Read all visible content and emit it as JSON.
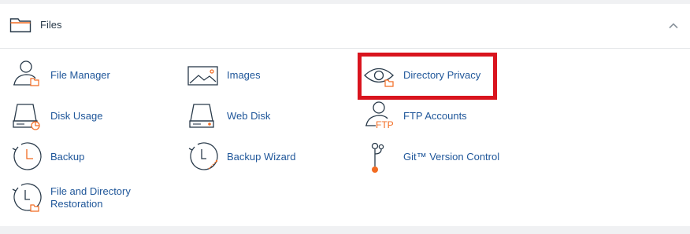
{
  "section": {
    "title": "Files",
    "icon": "folder-icon",
    "collapse_icon": "chevron-up-icon"
  },
  "items": [
    {
      "label": "File Manager",
      "icon": "file-manager-icon"
    },
    {
      "label": "Images",
      "icon": "images-icon"
    },
    {
      "label": "Directory Privacy",
      "icon": "directory-privacy-icon"
    },
    {
      "label": "Disk Usage",
      "icon": "disk-usage-icon"
    },
    {
      "label": "Web Disk",
      "icon": "web-disk-icon"
    },
    {
      "label": "FTP Accounts",
      "icon": "ftp-accounts-icon"
    },
    {
      "label": "Backup",
      "icon": "backup-icon"
    },
    {
      "label": "Backup Wizard",
      "icon": "backup-wizard-icon"
    },
    {
      "label": "Git™ Version Control",
      "icon": "git-version-control-icon"
    },
    {
      "label": "File and Directory Restoration",
      "icon": "file-directory-restoration-icon"
    }
  ],
  "highlight": {
    "target": "Directory Privacy",
    "color": "#d9141e"
  },
  "colors": {
    "link": "#20579a",
    "icon_stroke": "#293a4a",
    "accent": "#f26b21"
  }
}
